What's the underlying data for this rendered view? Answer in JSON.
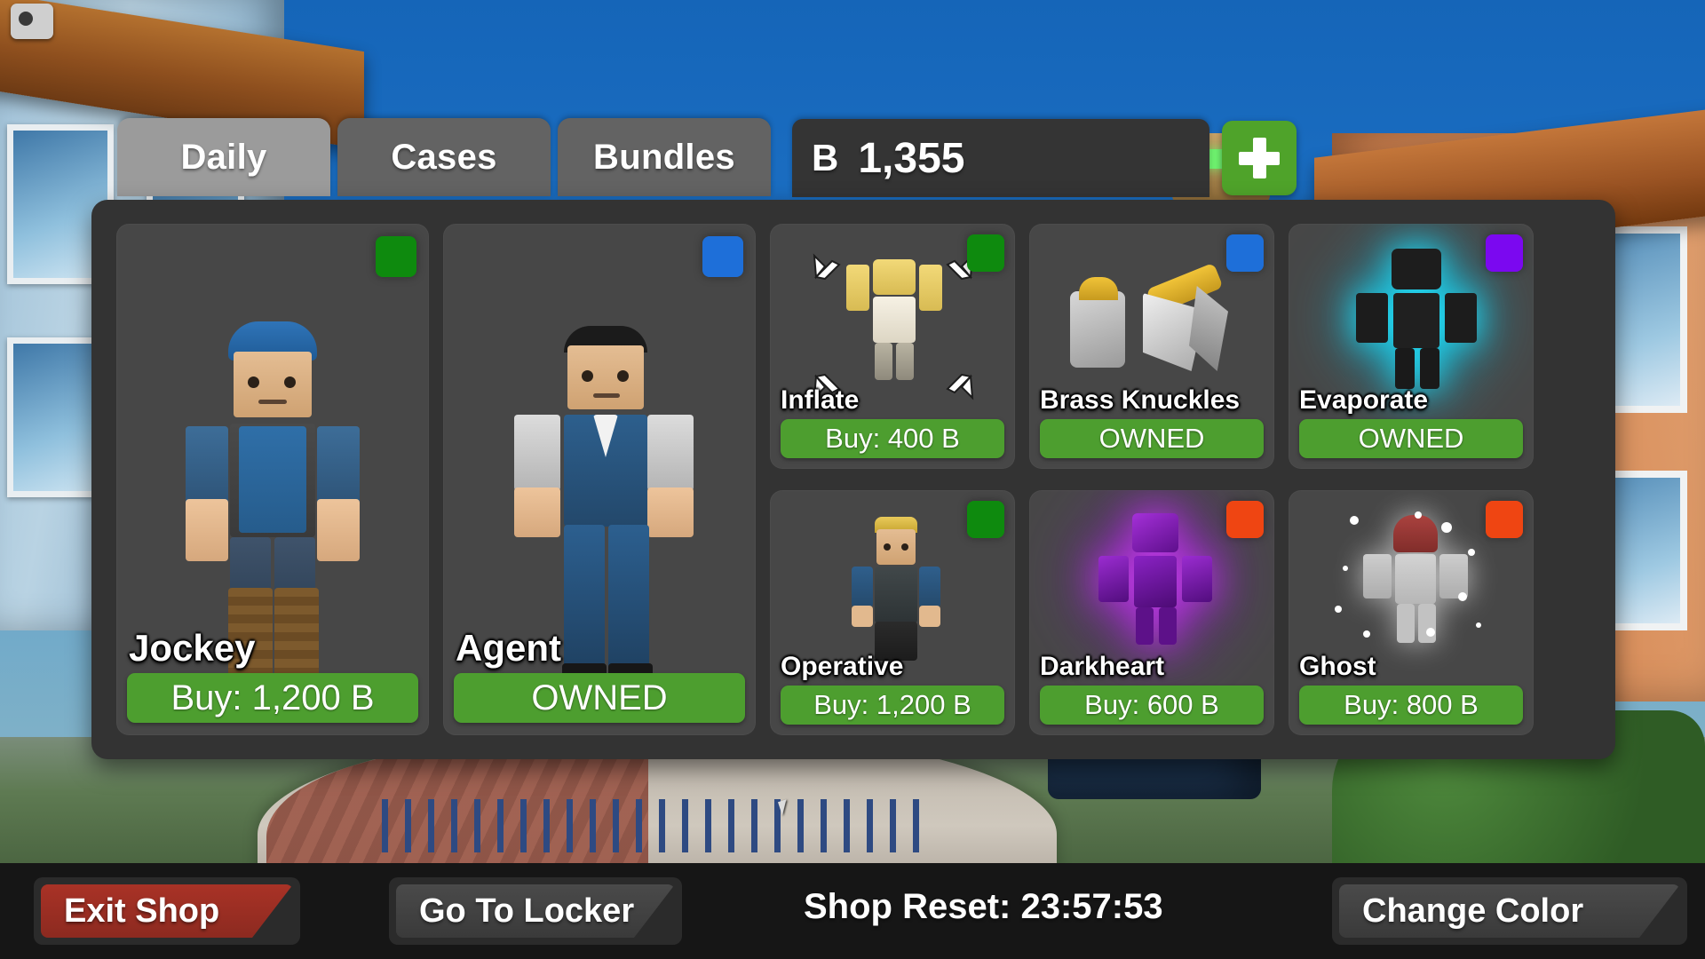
{
  "header": {
    "tabs": [
      {
        "label": "Daily",
        "state": "active"
      },
      {
        "label": "Cases",
        "state": "idle"
      },
      {
        "label": "Bundles",
        "state": "idle"
      }
    ],
    "currency": {
      "symbol": "B",
      "amount": "1,355",
      "add_icon": "plus-icon"
    }
  },
  "shop": {
    "items": [
      {
        "name": "Jockey",
        "action": "Buy: 1,200 B",
        "owned": false,
        "rarity_color": "#0e8a0e",
        "size": "large"
      },
      {
        "name": "Agent",
        "action": "OWNED",
        "owned": true,
        "rarity_color": "#1e6fd9",
        "size": "large"
      },
      {
        "name": "Inflate",
        "action": "Buy: 400 B",
        "owned": false,
        "rarity_color": "#0e8a0e",
        "size": "small"
      },
      {
        "name": "Brass Knuckles",
        "action": "OWNED",
        "owned": true,
        "rarity_color": "#1e6fd9",
        "size": "small"
      },
      {
        "name": "Evaporate",
        "action": "OWNED",
        "owned": true,
        "rarity_color": "#7b08f0",
        "size": "small"
      },
      {
        "name": "Operative",
        "action": "Buy: 1,200 B",
        "owned": false,
        "rarity_color": "#0e8a0e",
        "size": "small"
      },
      {
        "name": "Darkheart",
        "action": "Buy: 600 B",
        "owned": false,
        "rarity_color": "#ef4512",
        "size": "small"
      },
      {
        "name": "Ghost",
        "action": "Buy: 800 B",
        "owned": false,
        "rarity_color": "#ef4512",
        "size": "small"
      }
    ]
  },
  "footer": {
    "exit_shop": "Exit Shop",
    "go_to_locker": "Go To Locker",
    "shop_reset": "Shop Reset: 23:57:53",
    "change_color": "Change Color"
  },
  "colors": {
    "buy_green": "#4d9e2f",
    "exit_red": "#a93226",
    "panel_bg": "#333333",
    "card_bg": "#474747",
    "tab_active": "#9b9b9b",
    "tab_idle": "#636363",
    "bottom_bar": "#161616",
    "add_button_green": "#4fa32a"
  }
}
